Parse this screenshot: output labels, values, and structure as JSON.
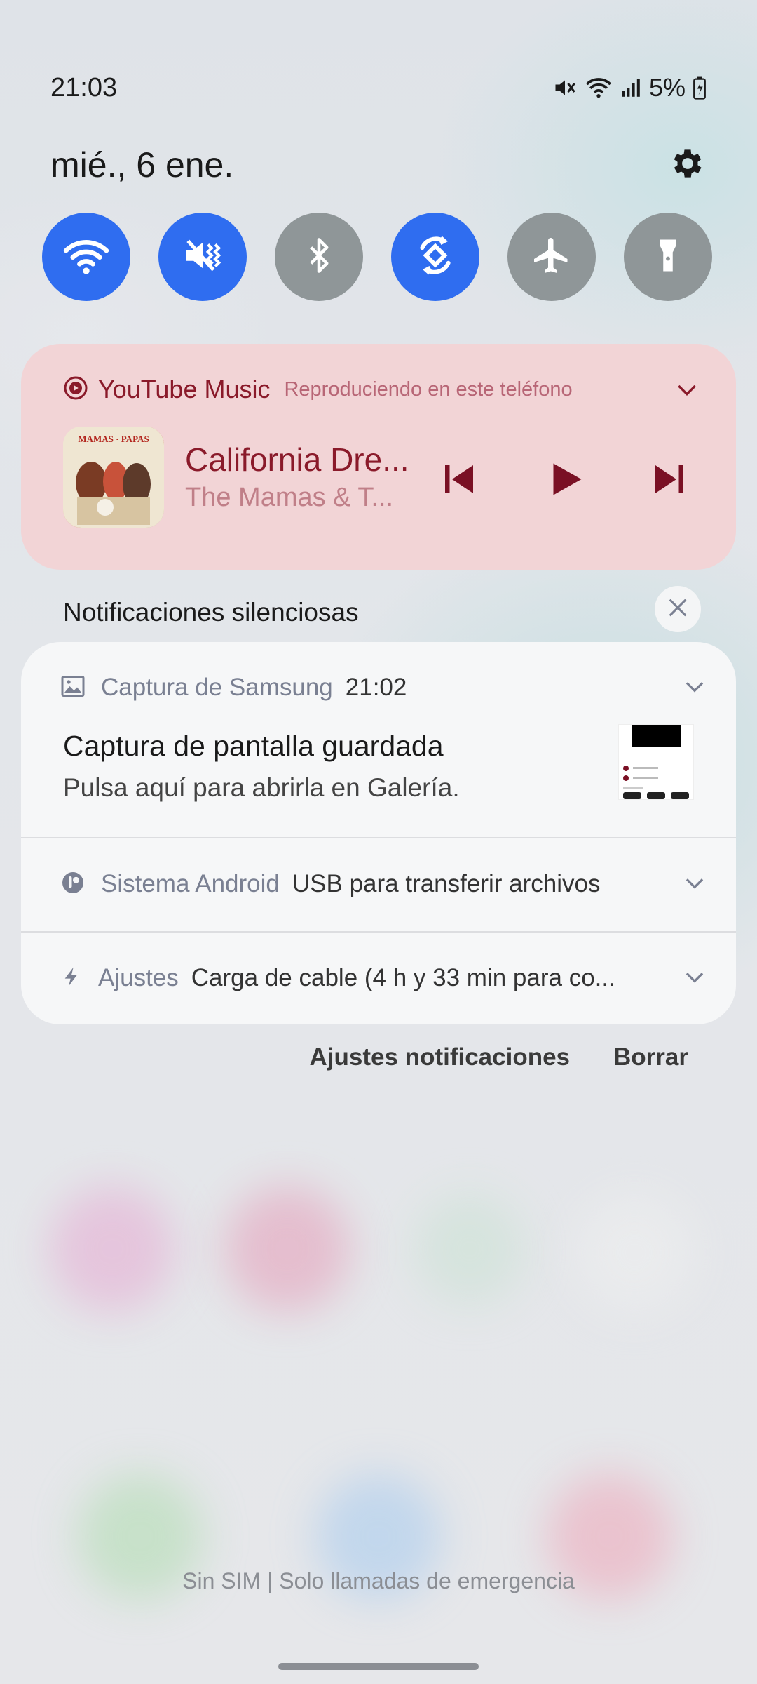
{
  "status_bar": {
    "time": "21:03",
    "battery": "5%",
    "icons": [
      "mute-icon",
      "wifi-icon",
      "signal-icon",
      "battery-charging-icon"
    ]
  },
  "panel": {
    "date": "mié., 6 ene.",
    "quick_settings": [
      {
        "name": "wifi",
        "on": true
      },
      {
        "name": "sound-mute",
        "on": true
      },
      {
        "name": "bluetooth",
        "on": false
      },
      {
        "name": "auto-rotate",
        "on": true
      },
      {
        "name": "airplane-mode",
        "on": false
      },
      {
        "name": "flashlight",
        "on": false
      }
    ],
    "colors": {
      "tile_on": "#2f6df0",
      "tile_off": "#8f9698"
    }
  },
  "media": {
    "app": "YouTube Music",
    "status": "Reproduciendo en este teléfono",
    "title": "California Dre...",
    "artist": "The Mamas & T...",
    "accent": "#8a1a2a",
    "background": "#f2d4d6"
  },
  "silent": {
    "label": "Notificaciones silenciosas"
  },
  "notifications": [
    {
      "app": "Captura de Samsung",
      "time": "21:02",
      "title": "Captura de pantalla guardada",
      "text": "Pulsa aquí para abrirla en Galería."
    },
    {
      "app": "Sistema Android",
      "text": "USB para transferir archivos"
    },
    {
      "app": "Ajustes",
      "text": "Carga de cable (4 h y 33 min para co..."
    }
  ],
  "actions": {
    "settings": "Ajustes notificaciones",
    "clear": "Borrar"
  },
  "footer": {
    "sim": "Sin SIM | Solo llamadas de emergencia"
  }
}
